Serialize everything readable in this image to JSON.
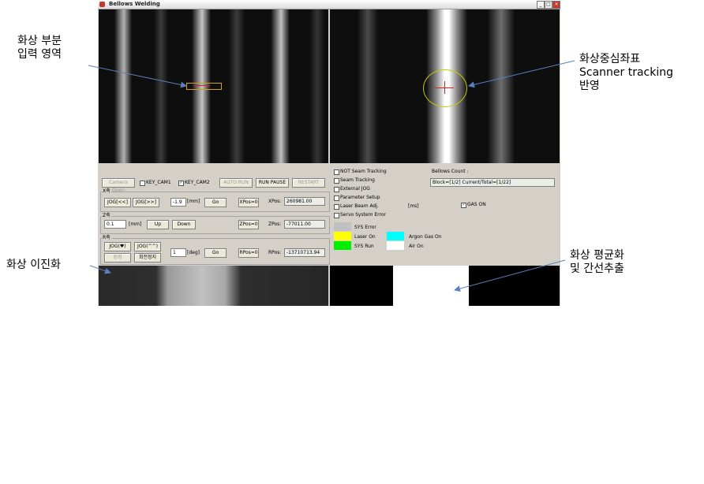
{
  "window": {
    "title": "Bellows Welding",
    "buttons": {
      "minimize": "_",
      "maximize": "□",
      "close": "×"
    }
  },
  "controls": {
    "camera_open": "Camera Open",
    "key_cam1": "KEY_CAM1",
    "key_cam2": "KEY_CAM2",
    "key_cam1_checked": false,
    "key_cam2_checked": true,
    "auto_run": "AUTO RUN",
    "run_pause": "RUN PAUSE",
    "restart": "RESTART"
  },
  "x_axis": {
    "heading": "X축",
    "jog_left": "JOG[<<]",
    "jog_right": "JOG[>>]",
    "value": "-1.9",
    "unit": "[mm]",
    "go": "Go",
    "zero": "XPos=0",
    "pos_label": "XPos:",
    "pos_value": "260981.00"
  },
  "z_axis": {
    "heading": "Z축",
    "value": "0.1",
    "unit": "[mm]",
    "up": "Up",
    "down": "Down",
    "zero": "ZPos=0",
    "pos_label": "ZPos:",
    "pos_value": "-77011.00"
  },
  "r_axis": {
    "heading": "R축",
    "jog_cw": "JOG(♥)",
    "jog_ccw": "JOG(^^)",
    "origin": "원점",
    "rotate_stop": "회전정지",
    "value": "1",
    "unit": "[deg]",
    "go": "Go",
    "zero": "RPos=0",
    "pos_label": "RPos:",
    "pos_value": "-13710713.94"
  },
  "options": {
    "items": [
      {
        "label": "NOT Seam Tracking",
        "checked": false
      },
      {
        "label": "Seam Tracking",
        "checked": false
      },
      {
        "label": "External JOG",
        "checked": false
      },
      {
        "label": "Parameter Setup",
        "checked": false
      },
      {
        "label": "Laser Beam Adj.",
        "checked": false
      },
      {
        "label": "Servo System Error",
        "checked": false
      }
    ],
    "ms_unit": "[ms]",
    "gas_on": "GAS ON",
    "gas_on_checked": true,
    "bellows_count_label": "Bellows Count :",
    "bellows_count_value": "Block=[1/2] Current/Total=[1/22]"
  },
  "status": {
    "sys_error": {
      "label": "SYS Error",
      "color": "#c0c0c0"
    },
    "laser_on": {
      "label": "Laser On",
      "color": "#ffff00"
    },
    "argon_gas_on": {
      "label": "Argon Gas On",
      "color": "#00ffff"
    },
    "sys_run": {
      "label": "SYS Run",
      "color": "#00ee00"
    },
    "air_on": {
      "label": "Air On",
      "color": "#ffffff"
    }
  },
  "annotations": {
    "input_region_line1": "화상 부분",
    "input_region_line2": "입력 영역",
    "center_line1": "화상중심좌표",
    "center_line2": "Scanner tracking",
    "center_line3": "반영",
    "binarize": "화상 이진화",
    "average_line1": "화상 평균화",
    "average_line2": "및 간선추출"
  },
  "colors": {
    "window_bg": "#d4d0c8",
    "roi_box": "#d4a017",
    "tracking_circle": "#c8c800",
    "tracking_cross": "#e02020",
    "arrow": "#5b7fbf"
  }
}
